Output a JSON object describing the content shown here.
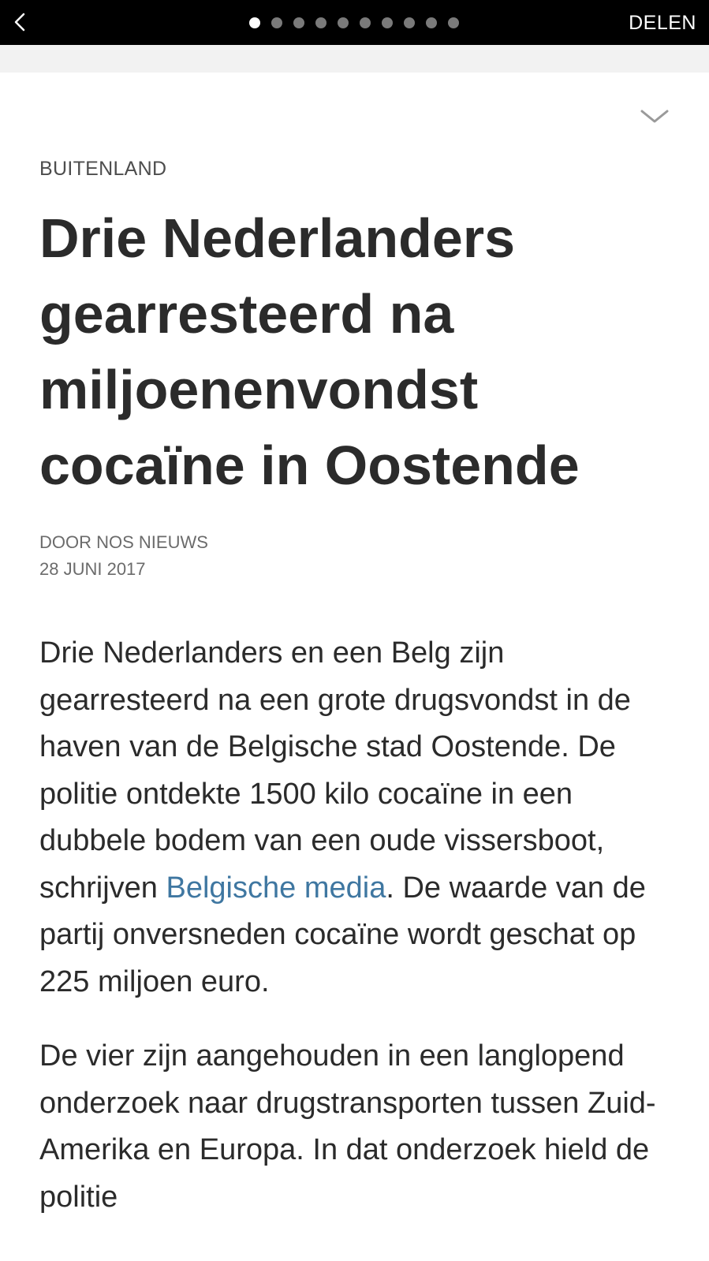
{
  "topbar": {
    "back_icon": "chevron-left-icon",
    "pager": {
      "total": 10,
      "active_index": 0
    },
    "share_label": "DELEN"
  },
  "article": {
    "collapse_icon": "chevron-down-icon",
    "category": "BUITENLAND",
    "title": "Drie Nederlanders gearresteerd na miljoenenvondst cocaïne in Oostende",
    "byline_author": "DOOR NOS NIEUWS",
    "byline_date": "28 JUNI 2017",
    "paragraph1_before_link": "Drie Nederlanders en een Belg zijn gearresteerd na een grote drugsvondst in de haven van de Belgische stad Oostende. De politie ontdekte 1500 kilo cocaïne in een dubbele bodem van een oude vissersboot, schrijven ",
    "paragraph1_link": "Belgische media",
    "paragraph1_after_link": ". De waarde van de partij onversneden cocaïne wordt geschat op 225 miljoen euro.",
    "paragraph2": "De vier zijn aangehouden in een langlopend onderzoek naar drugstransporten tussen Zuid-Amerika en Europa. In dat onderzoek hield de politie"
  },
  "colors": {
    "link": "#3f77a1",
    "topbar_bg": "#000000",
    "text": "#2b2b2b"
  }
}
